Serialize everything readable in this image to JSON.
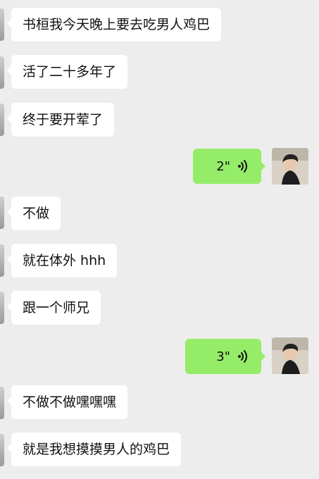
{
  "messages": [
    {
      "text": "书桓我今天晚上要去吃男人鸡巴"
    },
    {
      "text": "活了二十多年了"
    },
    {
      "text": "终于要开荤了"
    },
    {
      "duration": "2\""
    },
    {
      "text": "不做"
    },
    {
      "text": "就在体外 hhh"
    },
    {
      "text": "跟一个师兄"
    },
    {
      "duration": "3\""
    },
    {
      "text": "不做不做嘿嘿嘿"
    },
    {
      "text": "就是我想摸摸男人的鸡巴"
    }
  ],
  "icons": {
    "voice_wave": "wifi-like-voice-icon",
    "avatar": "user-avatar"
  },
  "colors": {
    "background": "#ededed",
    "incoming_bubble": "#ffffff",
    "outgoing_bubble": "#95ec69"
  }
}
